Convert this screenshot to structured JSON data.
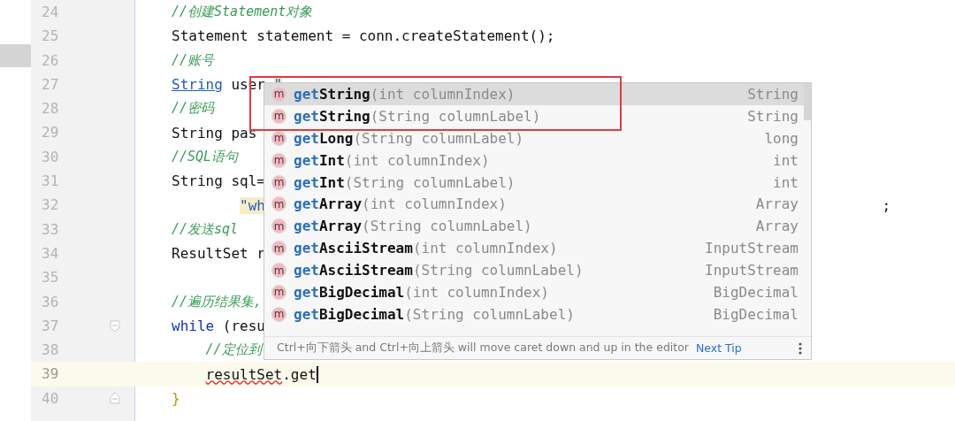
{
  "editor": {
    "lines": [
      {
        "number": "24",
        "tokens": [
          {
            "kind": "comment",
            "text": "//创建Statement对象"
          }
        ]
      },
      {
        "number": "25",
        "tokens": [
          {
            "kind": "plain",
            "text": "Statement statement = conn.createStatement();"
          }
        ]
      },
      {
        "number": "26",
        "tokens": [
          {
            "kind": "comment",
            "text": "//账号"
          }
        ]
      },
      {
        "number": "27",
        "tokens": [
          {
            "kind": "link",
            "text": "String"
          },
          {
            "kind": "plain",
            "text": " user "
          },
          {
            "kind": "string",
            "text": "\""
          }
        ]
      },
      {
        "number": "28",
        "tokens": [
          {
            "kind": "comment",
            "text": "//密码"
          }
        ]
      },
      {
        "number": "29",
        "tokens": [
          {
            "kind": "plain",
            "text": "String pas"
          }
        ]
      },
      {
        "number": "30",
        "tokens": [
          {
            "kind": "comment",
            "text": "//SQL语句"
          }
        ]
      },
      {
        "number": "31",
        "tokens": [
          {
            "kind": "plain",
            "text": "String sql="
          }
        ],
        "children": [
          {
            "number": "32",
            "continuation": true,
            "tokens": [
              {
                "kind": "string",
                "text": "\"wh"
              },
              {
                "kind": "tail",
                "text": ";"
              }
            ]
          }
        ]
      },
      {
        "number": "33",
        "tokens": [
          {
            "kind": "comment",
            "text": "//发送sql"
          }
        ]
      },
      {
        "number": "34",
        "tokens": [
          {
            "kind": "plain",
            "text": "ResultSet r"
          }
        ]
      },
      {
        "number": "35"
      },
      {
        "number": "36",
        "tokens": [
          {
            "kind": "comment",
            "text": "//遍历结果集,"
          }
        ]
      },
      {
        "number": "37",
        "fold_start": true,
        "tokens": [
          {
            "kind": "keyword",
            "text": "while"
          },
          {
            "kind": "plain",
            "text": " (resu"
          }
        ],
        "children": [
          {
            "number": "38",
            "tokens": [
              {
                "kind": "comment",
                "text": "//定位到"
              }
            ]
          },
          {
            "number": "39",
            "current": true,
            "tokens": [
              {
                "kind": "error",
                "text": "resultSet"
              },
              {
                "kind": "plain",
                "text": ".get"
              }
            ]
          }
        ]
      },
      {
        "number": "40",
        "fold_end": true,
        "tokens": [
          {
            "kind": "brace",
            "text": "}"
          }
        ]
      }
    ]
  },
  "completion": {
    "items": [
      {
        "badge": "m",
        "match": "get",
        "name": "String",
        "params": "(int columnIndex)",
        "type": "String",
        "selected": true
      },
      {
        "badge": "m",
        "match": "get",
        "name": "String",
        "params": "(String columnLabel)",
        "type": "String",
        "selected": false
      },
      {
        "badge": "m",
        "match": "get",
        "name": "Long",
        "params": "(String columnLabel)",
        "type": "long",
        "selected": false
      },
      {
        "badge": "m",
        "match": "get",
        "name": "Int",
        "params": "(int columnIndex)",
        "type": "int",
        "selected": false
      },
      {
        "badge": "m",
        "match": "get",
        "name": "Int",
        "params": "(String columnLabel)",
        "type": "int",
        "selected": false
      },
      {
        "badge": "m",
        "match": "get",
        "name": "Array",
        "params": "(int columnIndex)",
        "type": "Array",
        "selected": false
      },
      {
        "badge": "m",
        "match": "get",
        "name": "Array",
        "params": "(String columnLabel)",
        "type": "Array",
        "selected": false
      },
      {
        "badge": "m",
        "match": "get",
        "name": "AsciiStream",
        "params": "(int columnIndex)",
        "type": "InputStream",
        "selected": false
      },
      {
        "badge": "m",
        "match": "get",
        "name": "AsciiStream",
        "params": "(String columnLabel)",
        "type": "InputStream",
        "selected": false
      },
      {
        "badge": "m",
        "match": "get",
        "name": "BigDecimal",
        "params": "(int columnIndex)",
        "type": "BigDecimal",
        "selected": false
      },
      {
        "badge": "m",
        "match": "get",
        "name": "BigDecimal",
        "params": "(String columnLabel)",
        "type": "BigDecimal",
        "selected": false
      }
    ],
    "hint": "Ctrl+向下箭头 and Ctrl+向上箭头 will move caret down and up in the editor",
    "next_tip": "Next Tip"
  }
}
